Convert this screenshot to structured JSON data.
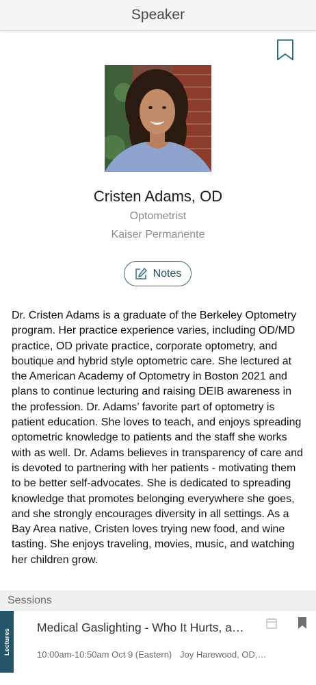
{
  "header": {
    "title": "Speaker"
  },
  "speaker": {
    "name": "Cristen Adams, OD",
    "title": "Optometrist",
    "organization": "Kaiser Permanente",
    "bio": "Dr. Cristen Adams is a graduate of the Berkeley Optometry program. Her practice experience varies, including OD/MD practice, OD private practice, corporate optometry, and boutique and hybrid style optometric care. She lectured at the American Academy of Optometry in Boston 2021 and plans to continue lecturing and raising DEIB awareness in the profession. Dr. Adams’ favorite part of optometry is patient education. She loves to teach, and enjoys spreading optometric knowledge to patients and the staff she works with as well. Dr. Adams believes in transparency of care and is devoted to partnering with her patients - motivating them to be better self-advocates. She is dedicated to spreading knowledge that promotes belonging everywhere she goes, and she strongly encourages diversity in all settings. As a Bay Area native, Cristen loves trying new food, and wine tasting. She enjoys traveling, movies, music, and watching her children grow."
  },
  "notes_button": {
    "label": "Notes",
    "icon": "edit-note-icon"
  },
  "sessions": {
    "label": "Sessions",
    "items": [
      {
        "category": "Lectures",
        "title": "Medical Gaslighting - Who It Hurts, a…",
        "time": "10:00am-10:50am Oct 9 (Eastern)",
        "presenters": "Joy Harewood, OD, …"
      }
    ]
  },
  "colors": {
    "accent": "#2f6b7f",
    "tab": "#23566a",
    "muted_text": "#8a8a8a"
  }
}
